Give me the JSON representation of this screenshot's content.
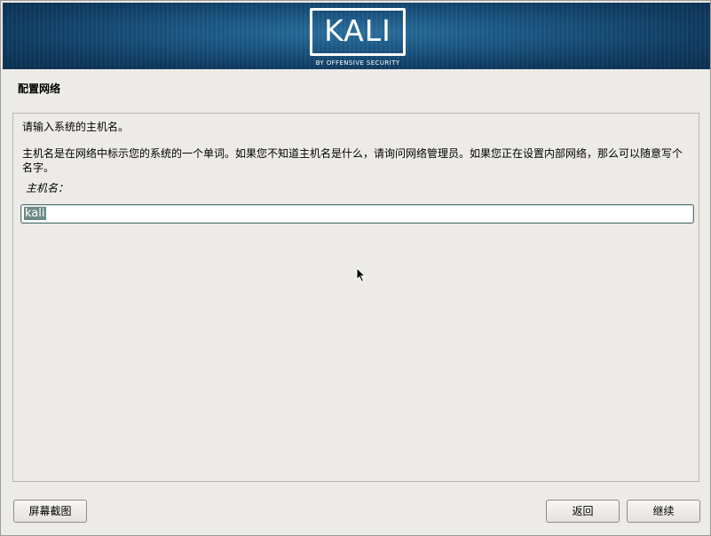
{
  "banner": {
    "logo_text": "KALI",
    "logo_subtitle": "BY OFFENSIVE SECURITY"
  },
  "page": {
    "title": "配置网络"
  },
  "content": {
    "prompt": "请输入系统的主机名。",
    "description": "主机名是在网络中标示您的系统的一个单词。如果您不知道主机名是什么，请询问网络管理员。如果您正在设置内部网络，那么可以随意写个名字。",
    "field_label": "主机名：",
    "hostname_value": "kali"
  },
  "buttons": {
    "screenshot": "屏幕截图",
    "back": "返回",
    "continue": "继续"
  },
  "icons": {
    "cursor": "mouse-pointer-icon"
  },
  "colors": {
    "banner": "#1b5683",
    "background": "#edebe7",
    "selection": "#6d8a86"
  }
}
